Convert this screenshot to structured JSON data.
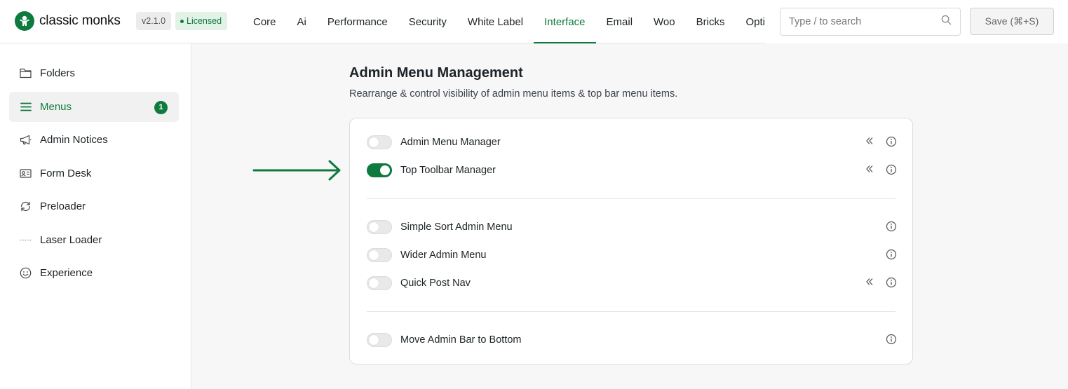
{
  "brand": {
    "name": "classic monks",
    "version": "v2.1.0",
    "license": "Licensed",
    "accent": "#0f7a3e"
  },
  "nav": {
    "tabs": [
      {
        "label": "Core"
      },
      {
        "label": "Ai"
      },
      {
        "label": "Performance"
      },
      {
        "label": "Security"
      },
      {
        "label": "White Label"
      },
      {
        "label": "Interface",
        "active": true
      },
      {
        "label": "Email"
      },
      {
        "label": "Woo"
      },
      {
        "label": "Bricks"
      },
      {
        "label": "Options"
      }
    ]
  },
  "search": {
    "placeholder": "Type / to search",
    "icon": "search-icon"
  },
  "save": {
    "label": "Save (⌘+S)"
  },
  "sidebar": {
    "items": [
      {
        "label": "Folders",
        "icon": "folder-icon"
      },
      {
        "label": "Menus",
        "icon": "menu-lines-icon",
        "active": true,
        "badge": "1"
      },
      {
        "label": "Admin Notices",
        "icon": "megaphone-icon"
      },
      {
        "label": "Form Desk",
        "icon": "id-card-icon"
      },
      {
        "label": "Preloader",
        "icon": "refresh-icon"
      },
      {
        "label": "Laser Loader",
        "icon": "dotted-line-icon"
      },
      {
        "label": "Experience",
        "icon": "smiley-icon"
      }
    ]
  },
  "main": {
    "title": "Admin Menu Management",
    "subtitle": "Rearrange & control visibility of admin menu items & top bar menu items.",
    "settings": [
      {
        "label": "Admin Menu Manager",
        "enabled": false,
        "has_expand": true
      },
      {
        "label": "Top Toolbar Manager",
        "enabled": true,
        "has_expand": true
      },
      {
        "label": "Simple Sort Admin Menu",
        "enabled": false,
        "has_expand": false
      },
      {
        "label": "Wider Admin Menu",
        "enabled": false,
        "has_expand": false
      },
      {
        "label": "Quick Post Nav",
        "enabled": false,
        "has_expand": true
      },
      {
        "label": "Move Admin Bar to Bottom",
        "enabled": false,
        "has_expand": false
      }
    ]
  }
}
